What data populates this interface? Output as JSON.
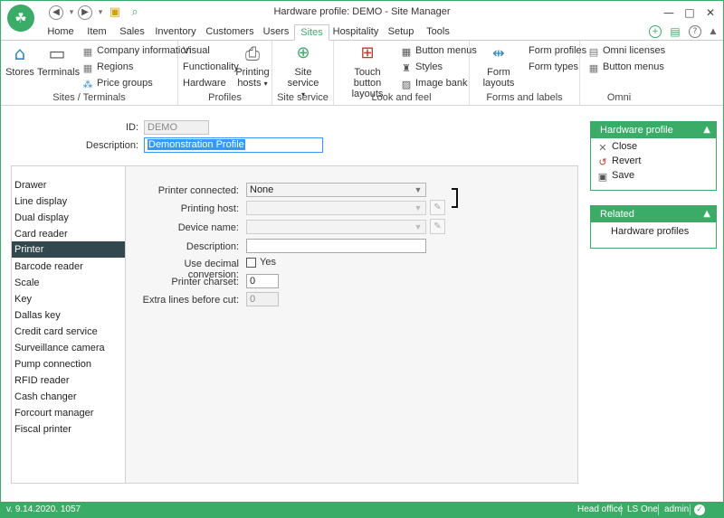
{
  "window": {
    "title": "Hardware profile: DEMO - Site Manager",
    "app_logo": "app-logo",
    "minimize": "—",
    "maximize": "□",
    "close": "✕"
  },
  "tabs": [
    "Home",
    "Item",
    "Sales",
    "Inventory",
    "Customers",
    "Users",
    "Sites",
    "Hospitality",
    "Setup",
    "Tools"
  ],
  "active_tab": "Sites",
  "ribbon": {
    "sites_terminals": {
      "label": "Sites / Terminals",
      "stores": "Stores",
      "terminals": "Terminals",
      "company_information": "Company information",
      "regions": "Regions",
      "price_groups": "Price groups"
    },
    "profiles": {
      "label": "Profiles",
      "visual": "Visual",
      "functionality": "Functionality",
      "hardware": "Hardware",
      "printing_hosts": "Printing hosts"
    },
    "site_service": {
      "label": "Site service",
      "site_service": "Site service"
    },
    "look_and_feel": {
      "label": "Look and feel",
      "touch_button_layouts": "Touch button layouts",
      "button_menus": "Button menus",
      "styles": "Styles",
      "image_bank": "Image bank"
    },
    "forms_and_labels": {
      "label": "Forms and labels",
      "form_layouts": "Form layouts",
      "form_profiles": "Form profiles",
      "form_types": "Form types"
    },
    "omni": {
      "label": "Omni",
      "omni_licenses": "Omni licenses",
      "button_menus": "Button menus"
    }
  },
  "header_form": {
    "id_label": "ID:",
    "id_value": "DEMO",
    "description_label": "Description:",
    "description_value": "Demonstration Profile"
  },
  "nav": {
    "items": [
      "Drawer",
      "Line display",
      "Dual display",
      "Card reader",
      "Printer",
      "Barcode reader",
      "Scale",
      "Key",
      "Dallas key",
      "Credit card service",
      "Surveillance camera",
      "Pump connection",
      "RFID reader",
      "Cash changer",
      "Forcourt manager",
      "Fiscal printer"
    ],
    "selected": "Printer"
  },
  "printer_form": {
    "printer_connected_label": "Printer connected:",
    "printer_connected_value": "None",
    "printing_host_label": "Printing host:",
    "printing_host_value": "",
    "device_name_label": "Device name:",
    "device_name_value": "",
    "description_label": "Description:",
    "description_value": "",
    "decimal_conversion_label": "Use decimal conversion:",
    "decimal_conversion_checkbox_label": "Yes",
    "decimal_conversion_checked": false,
    "printer_charset_label": "Printer charset:",
    "printer_charset_value": "0",
    "extra_lines_label": "Extra lines before cut:",
    "extra_lines_value": "0"
  },
  "hardware_profile_box": {
    "title": "Hardware profile",
    "close": "Close",
    "revert": "Revert",
    "save": "Save"
  },
  "related_box": {
    "title": "Related",
    "hardware_profiles": "Hardware profiles"
  },
  "status_bar": {
    "version": "v. 9.14.2020. 1057",
    "location": "Head office",
    "product": "LS One",
    "user": "admin"
  },
  "colors": {
    "accent": "#3bab68",
    "nav_selected": "#33474f",
    "selection": "#3399ff"
  }
}
